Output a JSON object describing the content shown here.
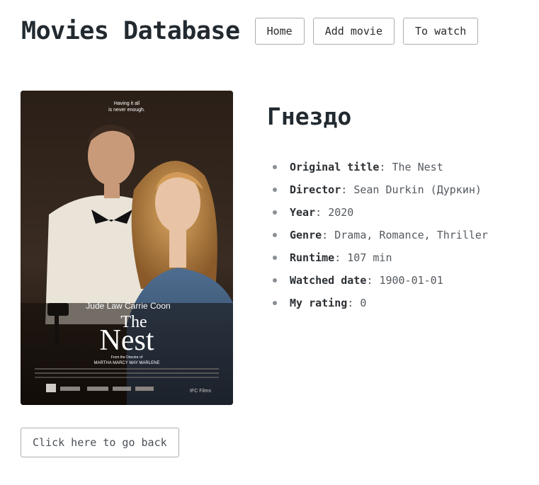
{
  "header": {
    "site_title": "Movies Database",
    "nav": [
      {
        "label": "Home"
      },
      {
        "label": "Add movie"
      },
      {
        "label": "To watch"
      }
    ]
  },
  "movie": {
    "title": "Гнездо",
    "poster": {
      "tagline_line1": "Having it all",
      "tagline_line2": "is never enough.",
      "actors": "Jude Law   Carrie Coon",
      "title_line1": "The",
      "title_line2": "Nest",
      "credit_line1": "From the Director of",
      "credit_line2": "MARTHA MARCY MAY MARLENE",
      "studio": "IFC Films"
    },
    "details": [
      {
        "label": "Original title",
        "value": "The Nest"
      },
      {
        "label": "Director",
        "value": "Sean Durkin (Дуркин)"
      },
      {
        "label": "Year",
        "value": "2020"
      },
      {
        "label": "Genre",
        "value": "Drama, Romance, Thriller"
      },
      {
        "label": "Runtime",
        "value": "107 min"
      },
      {
        "label": "Watched date",
        "value": "1900-01-01"
      },
      {
        "label": "My rating",
        "value": "0"
      }
    ]
  },
  "back_button": {
    "label": "Click here to go back"
  }
}
